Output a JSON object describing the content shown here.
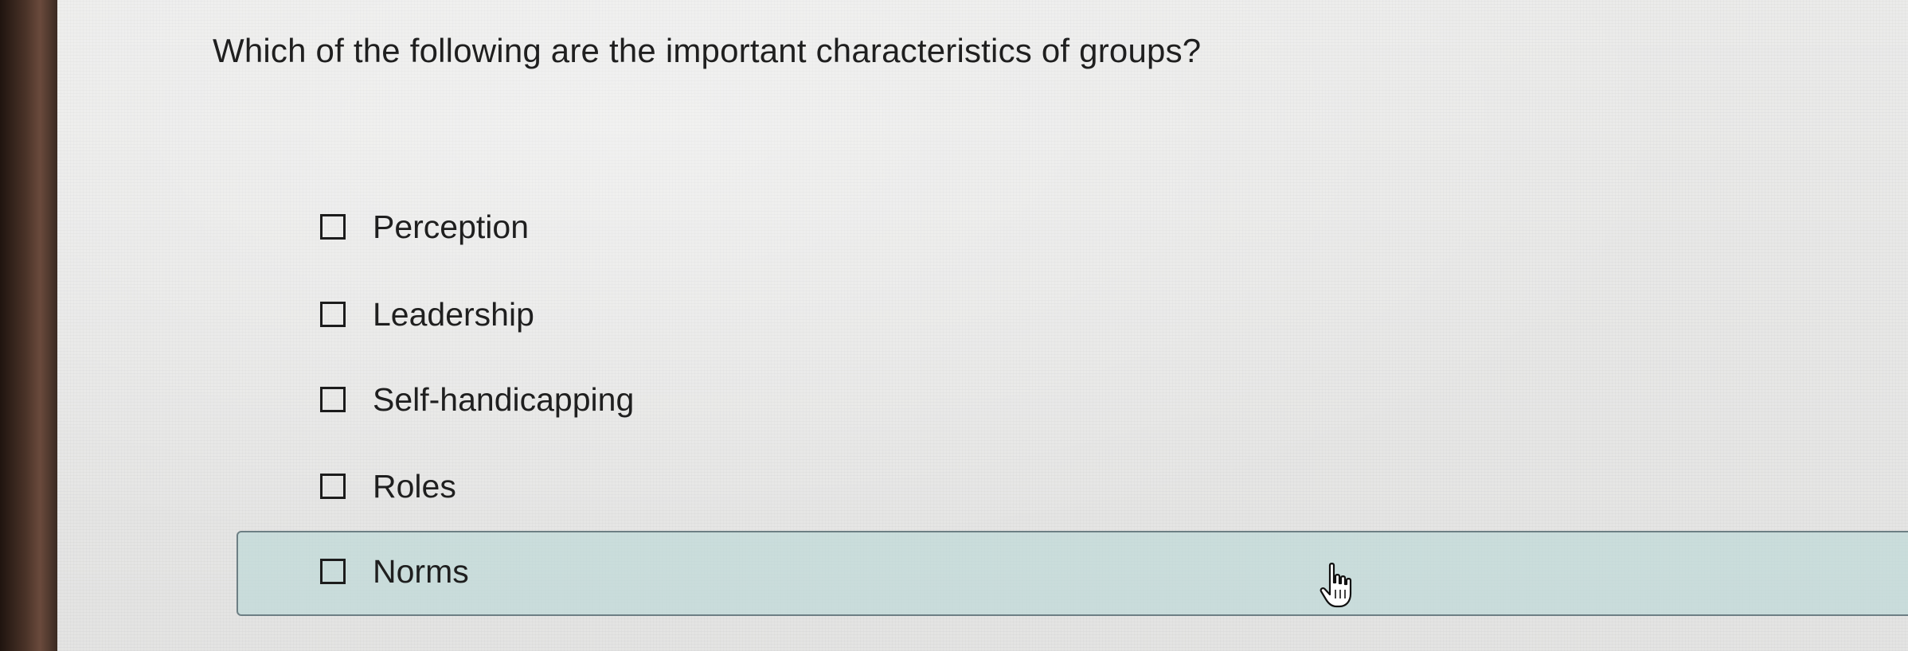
{
  "question": {
    "text": "Which of the following are the important characteristics of groups?"
  },
  "options": [
    {
      "label": "Perception",
      "checked": false
    },
    {
      "label": "Leadership",
      "checked": false
    },
    {
      "label": "Self-handicapping",
      "checked": false
    },
    {
      "label": "Roles",
      "checked": false
    },
    {
      "label": "Norms",
      "checked": false,
      "hovered": true
    }
  ],
  "cursor": {
    "icon": "hand-pointer-icon"
  },
  "colors": {
    "text": "#1f1f1f",
    "highlight_fill": "#c0dad8",
    "highlight_border": "#6d7f84"
  }
}
